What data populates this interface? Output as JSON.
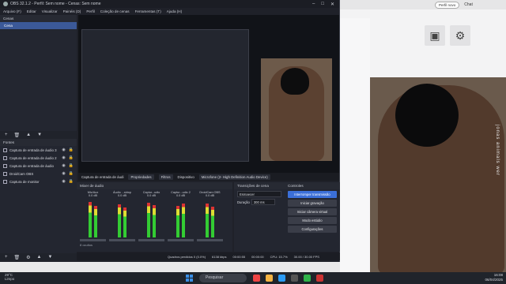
{
  "obs": {
    "title": "OBS 32.1.2 - Perfil: Sem nome - Cenas: Sem nome",
    "menu": [
      "Arquivo (F)",
      "Editar",
      "Visualizar",
      "Painéis (D)",
      "Perfil",
      "Coleção de cenas",
      "Ferramentas (T)",
      "Ajuda (H)"
    ],
    "scenes_title": "Cenas",
    "scene_items": [
      "Cena"
    ],
    "sources_title": "Fontes",
    "sources": [
      "Captura de entrada de áudio 3",
      "Captura de entrada de áudio 2",
      "Captura de entrada de áudio",
      "DroidCam OBS",
      "Captura de monitor"
    ],
    "context_bar": {
      "source": "Captura de entrada de áudi",
      "properties": "Propriedades",
      "filters": "Filtros",
      "device_label": "Dispositivo",
      "device": "Microfone (2- High Definition Audio Device)"
    },
    "mixer": {
      "title": "Mixer de áudio",
      "channels": [
        "Mic/Aux",
        "Áudio ...sktop",
        "Captur...udio",
        "Captur...udio 2",
        "DroidCam OBS"
      ],
      "level_db": "0.0 dB",
      "footer": "8 ocultos"
    },
    "transitions": {
      "title": "Transições de cena",
      "type": "Esmaecer",
      "duration_label": "Duração",
      "duration": "300 ms"
    },
    "controls": {
      "title": "Controles",
      "buttons": [
        "Interromper transmissão",
        "Iniciar gravação",
        "Iniciar câmera virtual",
        "Modo estúdio",
        "Configurações"
      ]
    },
    "status": {
      "frames_dropped": "Quadros perdidos 0 (0.0%)",
      "bitrate": "6138 kbps",
      "stream_time": "00:00:55",
      "rec_time": "00:00:00",
      "cpu": "CPU: 15.7%",
      "fps": "30.00 / 30.00 FPS"
    },
    "options_label": "Opções"
  },
  "right": {
    "profile_label": "Perfil novo",
    "chat_label": "Chat",
    "side_text": "jonas animals wer"
  },
  "taskbar": {
    "weather_temp": "29°C",
    "weather_desc": "Limpo",
    "search_placeholder": "Pesquisar",
    "time": "16:08",
    "date": "06/04/2025"
  },
  "colors": {
    "obs_bg": "#1f2129",
    "accent_blue": "#3b6fd8",
    "scene_selected": "#3b5998"
  }
}
